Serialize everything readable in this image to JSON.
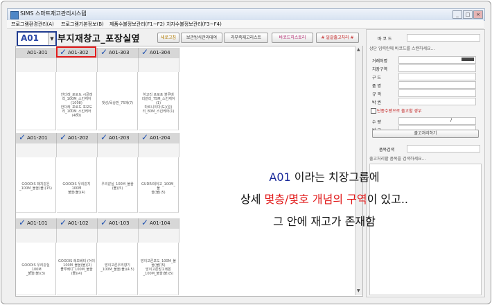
{
  "window": {
    "title": "SIMS 스마트재고관리시스템",
    "minimize": "_",
    "maximize": "□",
    "close": "×"
  },
  "menu": [
    "프로그램환경관리(A)",
    "프로그램기본정보(B)",
    "제품수불정보관리(F1~F2)",
    "치자수불정보관리(F3~F4)"
  ],
  "toolbar": {
    "group_value": "A01",
    "warehouse_name": "부지재창고_포장실옆",
    "buttons": [
      "새로고침",
      "보관방식관리대여",
      "과부족재고리스트",
      "바코드히스토리",
      "# 일괄출고처리 #"
    ]
  },
  "grid": {
    "rows": [
      {
        "cells": [
          {
            "code": "A01-301",
            "checked": false,
            "items": []
          },
          {
            "code": "A01-302",
            "checked": true,
            "items": []
          },
          {
            "code": "A01-303",
            "checked": true,
            "items": []
          },
          {
            "code": "A01-304",
            "checked": true,
            "items": []
          }
        ]
      },
      {
        "cells": [
          {
            "code": "A01-201",
            "checked": true,
            "items": [
              "GOODIS 패치같은",
              "_100M_불을(불)(15)"
            ]
          },
          {
            "code": "A01-202",
            "checked": true,
            "items": [
              "GOODIS 우리같지 100M",
              "불을(불)(4)"
            ]
          },
          {
            "code": "A01-203",
            "checked": true,
            "items": [
              "우리같실_100M_불을",
              "(불)(5)"
            ]
          },
          {
            "code": "A01-204",
            "checked": true,
            "items": [
              "GUDRI데이고_100M_불",
              "을(불)(5)"
            ]
          }
        ]
      },
      {
        "cells": [
          {
            "code": "A01-101",
            "checked": true,
            "items": [
              "GOODIS 우리같실_100M",
              "_불을(불)(3)"
            ]
          },
          {
            "code": "A01-102",
            "checked": true,
            "items": [
              "GOODIS 레모베티 (어이",
              "_100M_불을(불)(2)",
              "블루베디_100M_불을",
              "(불)(4)"
            ]
          },
          {
            "code": "A01-103",
            "checked": true,
            "items": [
              "망이고른우리향기",
              "_100M_불을(불)(4.5)"
            ]
          },
          {
            "code": "A01-104",
            "checked": true,
            "items": [
              "망이고른포도_100M_불",
              "을(불)(5)",
              "망이고른망고레몬",
              "_100M_불을(불)(5)"
            ]
          }
        ]
      }
    ],
    "row1_items": [
      [
        "한다레_포로도 시골래",
        "리_100M_스킨케어",
        "(1008)",
        "한다레_포로도 포모도",
        "리_100M_스킨케어",
        "(480)"
      ],
      [],
      [
        "댓성/목상판_75매(7)"
      ],
      [
        "하고리 포로포 블루베",
        "리같리_75M_스킨케어",
        "(1)",
        "마르니이다(도)(일)",
        "리_80M_스킨케어(1)"
      ]
    ]
  },
  "right_panel": {
    "barcode_label": "바 코 드",
    "scan_hint": "상단 입력란에 바코드를 스캔하세요...",
    "fields": [
      "거래처명",
      "치장구역",
      "구      드",
      "품      명",
      "규      격",
      "박      권"
    ],
    "check_label": "단종수량으로 출고할 경우",
    "qty_label": "수      량",
    "qty_sep": "/",
    "note_label": "비      고",
    "process_btn": "출고처리하기",
    "search_label": "품목검색",
    "search_hint": "출고처리할 품목을 검색하세요..."
  },
  "annotation": {
    "line1_a": "A01",
    "line1_b": " 이라는 치장그룹에",
    "line2_a": "상세 ",
    "line2_b": "몇층/몇호 개념의 구역",
    "line2_c": "이 있고..",
    "line3": "그 안에 재고가 존재함"
  },
  "colors": {
    "accent_blue": "#1f3b8f",
    "highlight_red": "#e31b1b",
    "check_blue": "#1c4fb0"
  }
}
